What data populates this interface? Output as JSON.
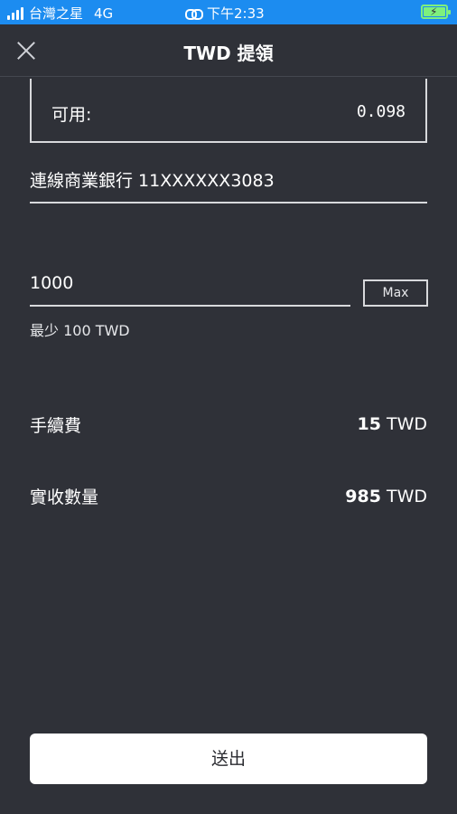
{
  "status_bar": {
    "carrier": "台灣之星",
    "network": "4G",
    "time": "下午2:33"
  },
  "header": {
    "title": "TWD 提領"
  },
  "available": {
    "label": "可用:",
    "value": "0.098"
  },
  "bank_account": {
    "value": "連線商業銀行 11XXXXXX3083"
  },
  "amount": {
    "value": "1000",
    "max_label": "Max",
    "min_note": "最少 100 TWD"
  },
  "fee": {
    "label": "手續費",
    "amount": "15",
    "unit": "TWD"
  },
  "received": {
    "label": "實收數量",
    "amount": "985",
    "unit": "TWD"
  },
  "submit_label": "送出",
  "colors": {
    "status_bar": "#1c8cf0",
    "background": "#2f3138",
    "battery": "#7ef07e"
  }
}
